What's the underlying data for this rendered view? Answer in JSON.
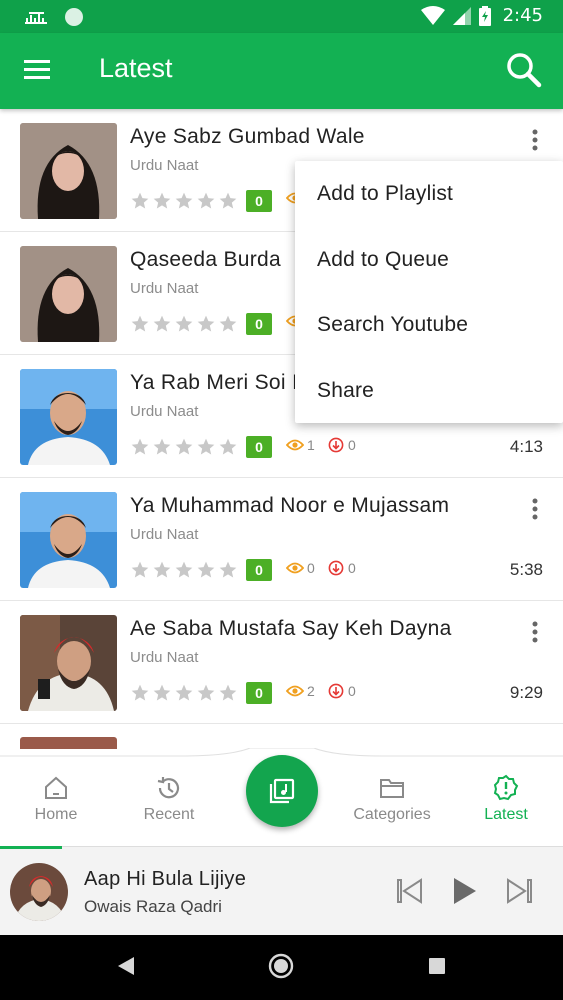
{
  "status_bar": {
    "time": "2:45"
  },
  "app_bar": {
    "title": "Latest"
  },
  "tracks": [
    {
      "title": "Aye Sabz Gumbad Wale",
      "subtitle": "Urdu Naat",
      "rating_badge": "0",
      "views": "",
      "downloads": "",
      "duration": "",
      "thumb": "female-reciter"
    },
    {
      "title": "Qaseeda Burda",
      "subtitle": "Urdu Naat",
      "rating_badge": "0",
      "views": "",
      "downloads": "",
      "duration": "",
      "thumb": "female-reciter"
    },
    {
      "title": "Ya Rab Meri Soi I",
      "subtitle": "Urdu Naat",
      "rating_badge": "0",
      "views": "1",
      "downloads": "0",
      "duration": "4:13",
      "thumb": "male-reciter-suit"
    },
    {
      "title": "Ya Muhammad Noor e Mujassam",
      "subtitle": "Urdu Naat",
      "rating_badge": "0",
      "views": "0",
      "downloads": "0",
      "duration": "5:38",
      "thumb": "male-reciter-suit"
    },
    {
      "title": "Ae Saba Mustafa Say Keh Dayna",
      "subtitle": "Urdu Naat",
      "rating_badge": "0",
      "views": "2",
      "downloads": "0",
      "duration": "9:29",
      "thumb": "male-reciter-turban"
    }
  ],
  "popup_menu": {
    "items": [
      "Add to Playlist",
      "Add to Queue",
      "Search Youtube",
      "Share"
    ]
  },
  "bottom_nav": {
    "items": [
      {
        "label": "Home",
        "icon": "home-icon",
        "active": false
      },
      {
        "label": "Recent",
        "icon": "history-icon",
        "active": false
      },
      {
        "label": "Categories",
        "icon": "folder-icon",
        "active": false
      },
      {
        "label": "Latest",
        "icon": "badge-alert-icon",
        "active": true
      }
    ],
    "fab_icon": "music-library-icon"
  },
  "now_playing": {
    "title": "Aap Hi Bula Lijiye",
    "artist": "Owais Raza Qadri",
    "progress": 0.11
  },
  "colors": {
    "primary": "#13b153",
    "status_bar": "#0fa14a",
    "badge": "#4caf26",
    "view_icon": "#f0a020",
    "download_icon": "#e53935"
  }
}
